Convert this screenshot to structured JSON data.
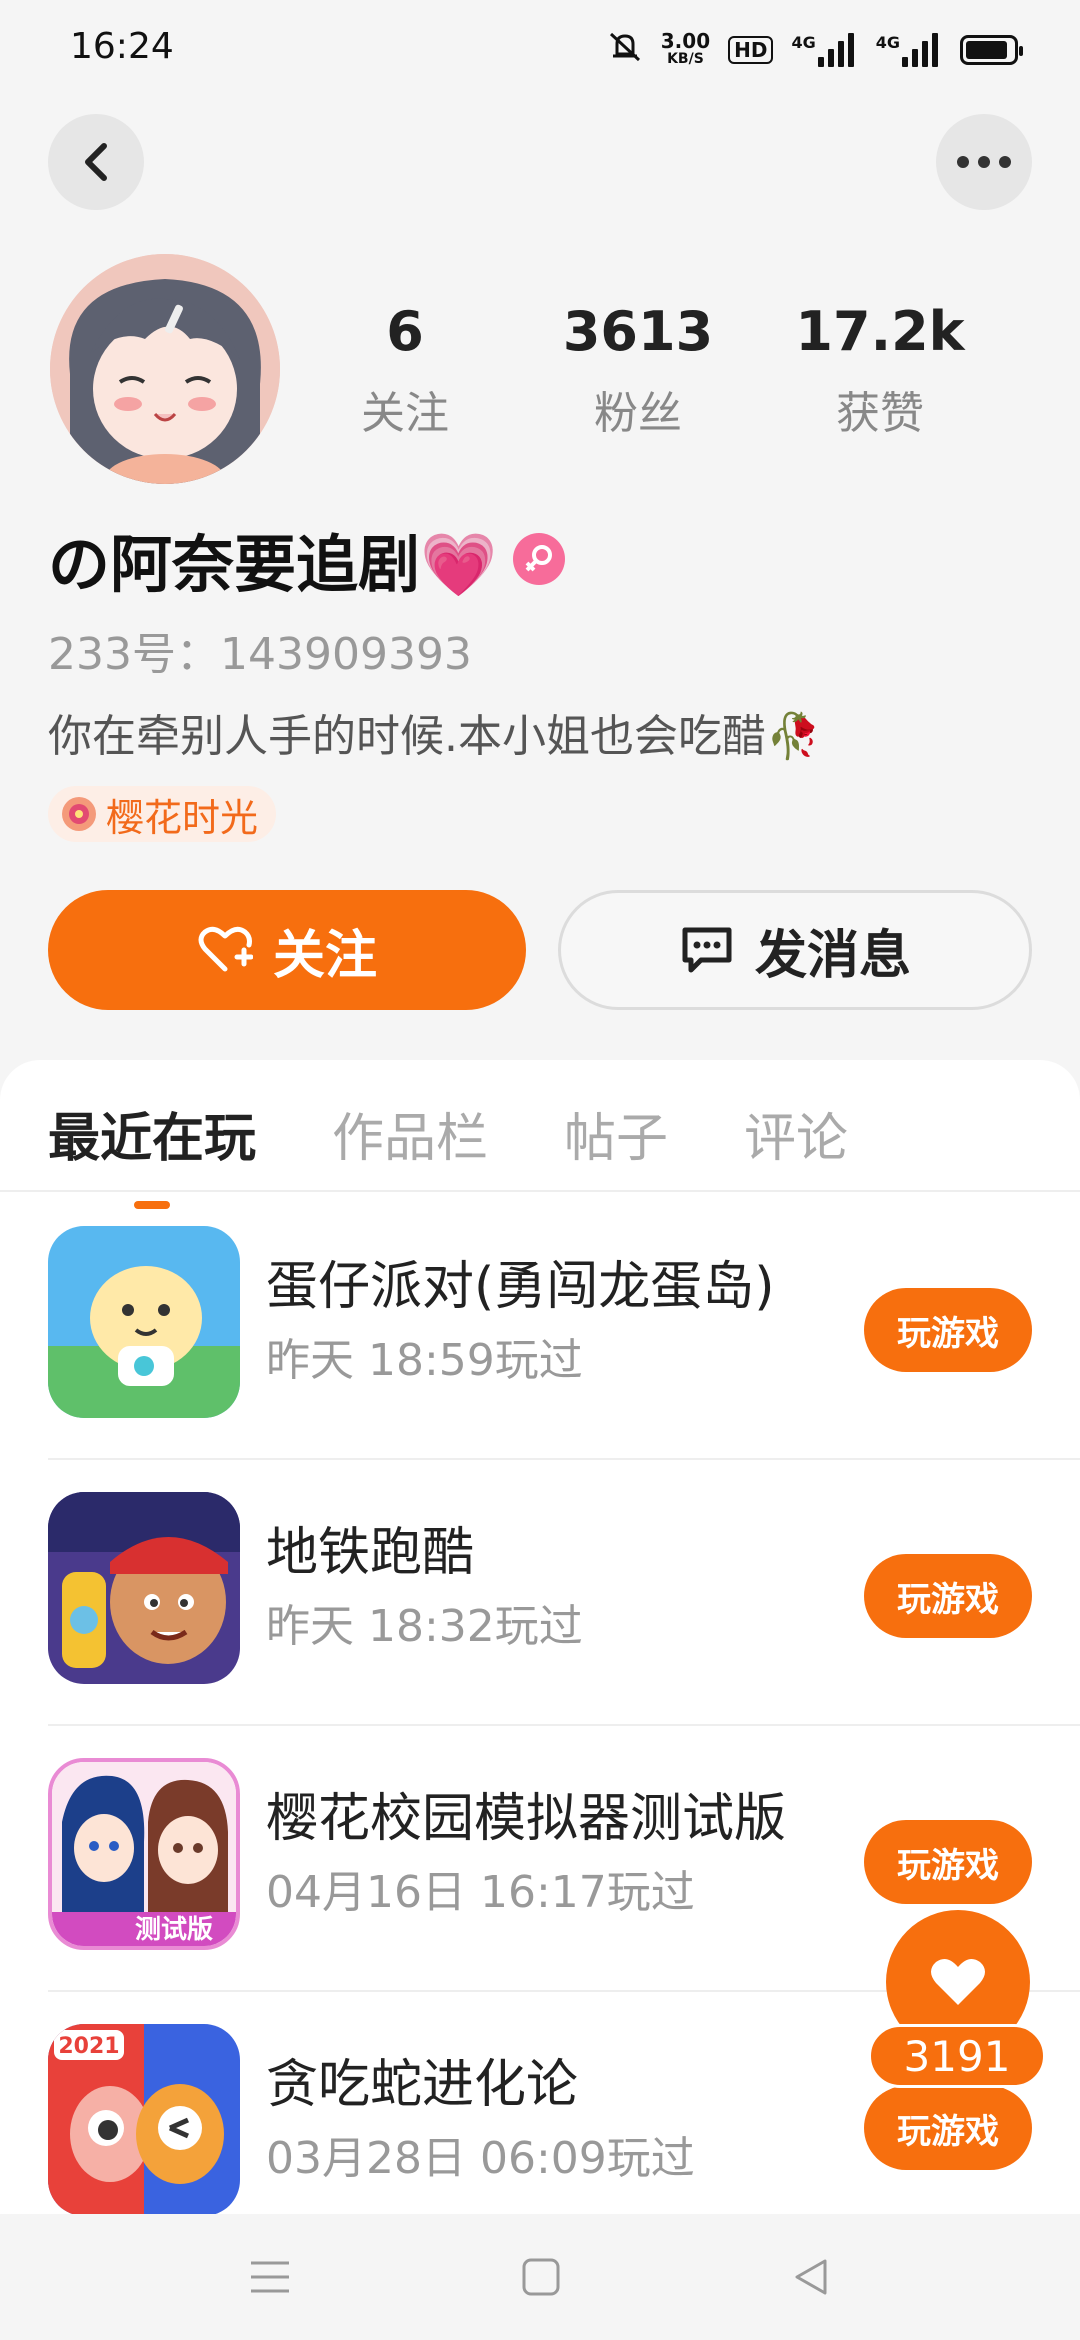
{
  "status_bar": {
    "time": "16:24",
    "net_speed_value": "3.00",
    "net_speed_unit": "KB/S",
    "hd_label": "HD",
    "net1": "4G",
    "net2": "4G",
    "battery_level": 0.9,
    "icons": [
      "mute-bell-icon",
      "hd-icon",
      "signal-icon",
      "battery-icon"
    ]
  },
  "header": {
    "back_icon": "chevron-left-icon",
    "more_icon": "more-dots-icon"
  },
  "profile": {
    "stats": [
      {
        "value": "6",
        "label": "关注"
      },
      {
        "value": "3613",
        "label": "粉丝"
      },
      {
        "value": "17.2k",
        "label": "获赞"
      }
    ],
    "nickname": "の阿奈要追剧💗",
    "gender": "female",
    "uid": "233号：143909393",
    "bio": "你在牵别人手的时候.本小姐也会吃醋🥀",
    "tag": "樱花时光"
  },
  "actions": {
    "follow": "关注",
    "message": "发消息"
  },
  "tabs": [
    "最近在玩",
    "作品栏",
    "帖子",
    "评论"
  ],
  "games": [
    {
      "name": "蛋仔派对(勇闯龙蛋岛)",
      "time": "昨天 18:59玩过",
      "button": "玩游戏"
    },
    {
      "name": "地铁跑酷",
      "time": "昨天 18:32玩过",
      "button": "玩游戏"
    },
    {
      "name": "樱花校园模拟器测试版",
      "time": "04月16日 16:17玩过",
      "button": "玩游戏"
    },
    {
      "name": "贪吃蛇进化论",
      "time": "03月28日 06:09玩过",
      "button": "玩游戏"
    }
  ],
  "game_icon_labels": {
    "test_badge": "测试版",
    "year": "2021"
  },
  "floating_like": {
    "count": "3191"
  },
  "colors": {
    "accent": "#f76f0e",
    "background": "#f5f5f5"
  }
}
